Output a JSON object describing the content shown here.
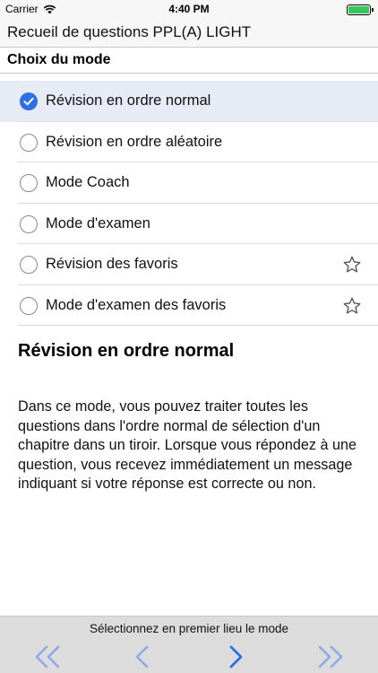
{
  "status_bar": {
    "carrier": "Carrier",
    "time": "4:40 PM",
    "icons": [
      "wifi-icon",
      "battery-icon"
    ]
  },
  "app": {
    "title": "Recueil de questions PPL(A) LIGHT"
  },
  "section": {
    "title": "Choix du mode"
  },
  "modes": [
    {
      "label": "Révision en ordre normal",
      "selected": true,
      "star": false
    },
    {
      "label": "Révision en ordre aléatoire",
      "selected": false,
      "star": false
    },
    {
      "label": "Mode Coach",
      "selected": false,
      "star": false
    },
    {
      "label": "Mode d'examen",
      "selected": false,
      "star": false
    },
    {
      "label": "Révision des favoris",
      "selected": false,
      "star": true
    },
    {
      "label": "Mode d'examen des favoris",
      "selected": false,
      "star": true
    }
  ],
  "description": {
    "title": "Révision en ordre normal",
    "text": "Dans ce mode, vous pouvez traiter toutes les questions dans l'ordre normal de sélection d'un chapitre dans un tiroir. Lorsque vous répondez à une question, vous recevez immédiatement un message indiquant si votre réponse est correcte ou non."
  },
  "toolbar": {
    "hint": "Sélectionnez en premier lieu le mode",
    "buttons": [
      "first-icon",
      "previous-icon",
      "next-icon",
      "last-icon"
    ]
  },
  "colors": {
    "accent": "#2f6fe4",
    "selected_row": "#e6ebf6",
    "toolbar_bg": "#dcdcdc",
    "disabled_nav": "#8fa9e6",
    "active_nav": "#2f6fe4"
  }
}
